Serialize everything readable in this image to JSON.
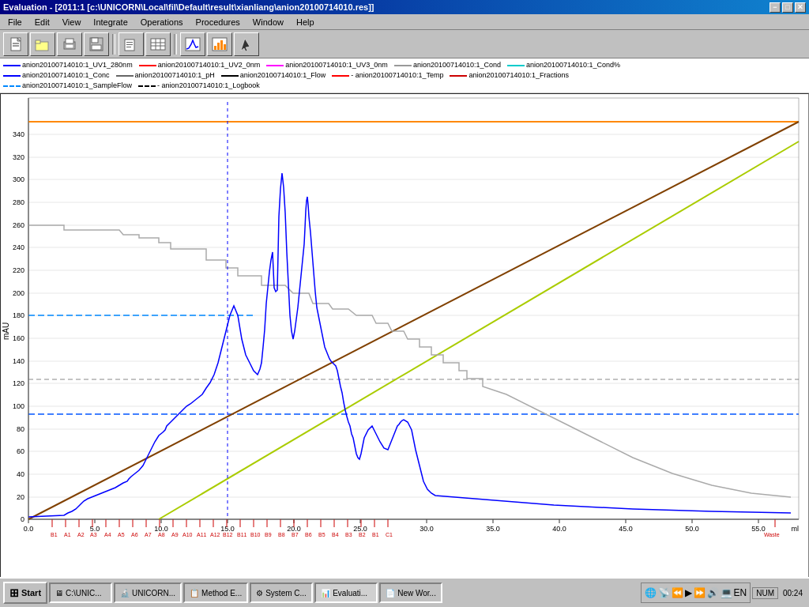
{
  "window": {
    "title": "Evaluation - [2011:1  [c:\\UNICORN\\Local\\fil\\Default\\result\\xianliang\\anion20100714010.res]]",
    "inner_title": "anion20100714010.res"
  },
  "titlebar": {
    "minimize": "−",
    "restore": "□",
    "close": "✕",
    "inner_minimize": "−",
    "inner_restore": "□",
    "inner_close": "✕"
  },
  "menu": {
    "items": [
      "File",
      "Edit",
      "View",
      "Integrate",
      "Operations",
      "Procedures",
      "Window",
      "Help"
    ]
  },
  "toolbar": {
    "buttons": [
      {
        "name": "new",
        "icon": "📄"
      },
      {
        "name": "open",
        "icon": "📂"
      },
      {
        "name": "print",
        "icon": "🖨"
      },
      {
        "name": "save",
        "icon": "💾"
      },
      {
        "name": "print2",
        "icon": "🖨"
      },
      {
        "name": "table",
        "icon": "▦"
      },
      {
        "name": "chromatogram",
        "icon": "📈"
      },
      {
        "name": "bar-chart",
        "icon": "📊"
      },
      {
        "name": "cursor",
        "icon": "✒"
      }
    ]
  },
  "legend": {
    "row1": [
      {
        "label": "anion20100714010:1_UV1_280nm",
        "color": "#0000ff",
        "style": "solid"
      },
      {
        "label": "anion20100714010:1_UV2_0nm",
        "color": "#ff0000",
        "style": "solid"
      },
      {
        "label": "anion20100714010:1_UV3_0nm",
        "color": "#ff00ff",
        "style": "solid"
      },
      {
        "label": "anion20100714010:1_Cond",
        "color": "#808080",
        "style": "solid"
      },
      {
        "label": "anion20100714010:1_Cond%",
        "color": "#00ffff",
        "style": "solid"
      }
    ],
    "row2": [
      {
        "label": "anion20100714010:1_Conc",
        "color": "#0000ff",
        "style": "solid"
      },
      {
        "label": "anion20100714010:1_pH",
        "color": "#808080",
        "style": "solid"
      },
      {
        "label": "anion20100714010:1_Flow",
        "color": "#000000",
        "style": "solid"
      },
      {
        "label": "anion20100714010:1_Temp",
        "color": "#ff0000",
        "style": "dashed"
      },
      {
        "label": "anion20100714010:1_Fractions",
        "color": "#ff0000",
        "style": "solid"
      }
    ],
    "row3": [
      {
        "label": "anion20100714010:1_SampleFlow",
        "color": "#00aaff",
        "style": "dashed"
      },
      {
        "label": "anion20100714010:1_Logbook",
        "color": "#000000",
        "style": "dashed"
      }
    ]
  },
  "chart": {
    "y_axis_label": "mAU",
    "x_axis_label": "ml",
    "y_ticks": [
      0,
      20,
      40,
      60,
      80,
      100,
      120,
      140,
      160,
      180,
      200,
      220,
      240,
      260,
      280,
      300,
      320,
      340
    ],
    "x_ticks": [
      0.0,
      5.0,
      10.0,
      15.0,
      20.0,
      25.0,
      30.0,
      35.0,
      40.0,
      45.0,
      50.0,
      55.0
    ],
    "fractions": [
      "B1",
      "A1",
      "A2",
      "A3",
      "A4",
      "A5",
      "A6",
      "A7",
      "A8",
      "A9",
      "A10",
      "A11",
      "A12",
      "B12",
      "B11",
      "B10",
      "B9",
      "B8",
      "B7",
      "B6",
      "B5",
      "B4",
      "B3",
      "B2",
      "B1",
      "C1",
      "Waste"
    ]
  },
  "statusbar": {
    "num": "NUM"
  },
  "taskbar": {
    "start_label": "Start",
    "items": [
      {
        "label": "C:\\UNIC...",
        "icon": "🖥"
      },
      {
        "label": "UNICORN...",
        "icon": "🔬"
      },
      {
        "label": "Method E...",
        "icon": "📋"
      },
      {
        "label": "System C...",
        "icon": "⚙"
      },
      {
        "label": "Evaluati...",
        "icon": "📊",
        "active": true
      },
      {
        "label": "New Wor...",
        "icon": "📄"
      }
    ],
    "time": "00:24"
  }
}
